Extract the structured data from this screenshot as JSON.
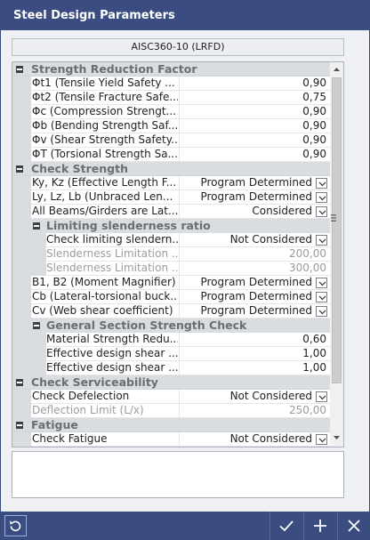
{
  "window": {
    "title": "Steel Design Parameters"
  },
  "design_code": "AISC360-10 (LRFD)",
  "grid": {
    "strength_reduction": {
      "title": "Strength Reduction Factor",
      "rows": [
        {
          "name": "Φt1 (Tensile Yield Safety ...",
          "value": "0,90"
        },
        {
          "name": "Φt2 (Tensile Fracture Safe...",
          "value": "0,75"
        },
        {
          "name": "Φc (Compression Strengt...",
          "value": "0,90"
        },
        {
          "name": "Φb (Bending Strength Saf...",
          "value": "0,90"
        },
        {
          "name": "Φv (Shear Strength Safety...",
          "value": "0,90"
        },
        {
          "name": "ΦT (Torsional Strength Sa...",
          "value": "0,90"
        }
      ]
    },
    "check_strength": {
      "title": "Check Strength",
      "rows": [
        {
          "name": "Ky, Kz (Effective Length F...",
          "value": "Program Determined"
        },
        {
          "name": "Ly, Lz, Lb (Unbraced Len...",
          "value": "Program Determined"
        },
        {
          "name": "All Beams/Girders are Lat...",
          "value": "Considered"
        }
      ],
      "limiting_slenderness": {
        "title": "Limiting slenderness ratio",
        "rows": [
          {
            "name": "Check limiting slendern...",
            "value": "Not Considered"
          },
          {
            "name": "Slenderness Limitation ...",
            "value": "200,00"
          },
          {
            "name": "Slenderness Limitation ...",
            "value": "300,00"
          }
        ]
      },
      "rows2": [
        {
          "name": "B1, B2 (Moment Magnifier)",
          "value": "Program Determined"
        },
        {
          "name": "Cb (Lateral-torsional buck...",
          "value": "Program Determined"
        },
        {
          "name": "Cv (Web shear coefficient)",
          "value": "Program Determined"
        }
      ],
      "general_section": {
        "title": "General Section Strength Check",
        "rows": [
          {
            "name": "Material Strength Redu...",
            "value": "0,60"
          },
          {
            "name": "Effective design shear ...",
            "value": "1,00"
          },
          {
            "name": "Effective design shear ...",
            "value": "1,00"
          }
        ]
      }
    },
    "check_serviceability": {
      "title": "Check Serviceability",
      "rows": [
        {
          "name": "Check Defelection",
          "value": "Not Considered"
        },
        {
          "name": "Deflection Limit (L/x)",
          "value": "250,00"
        }
      ]
    },
    "fatigue": {
      "title": "Fatigue",
      "rows": [
        {
          "name": "Check Fatigue",
          "value": "Not Considered"
        }
      ]
    }
  },
  "icons": {
    "reset": "refresh-icon",
    "ok": "checkmark-icon",
    "add": "plus-icon",
    "close": "close-icon"
  },
  "colors": {
    "titlebar": "#3b4d80",
    "category_band": "#d9dce1"
  }
}
